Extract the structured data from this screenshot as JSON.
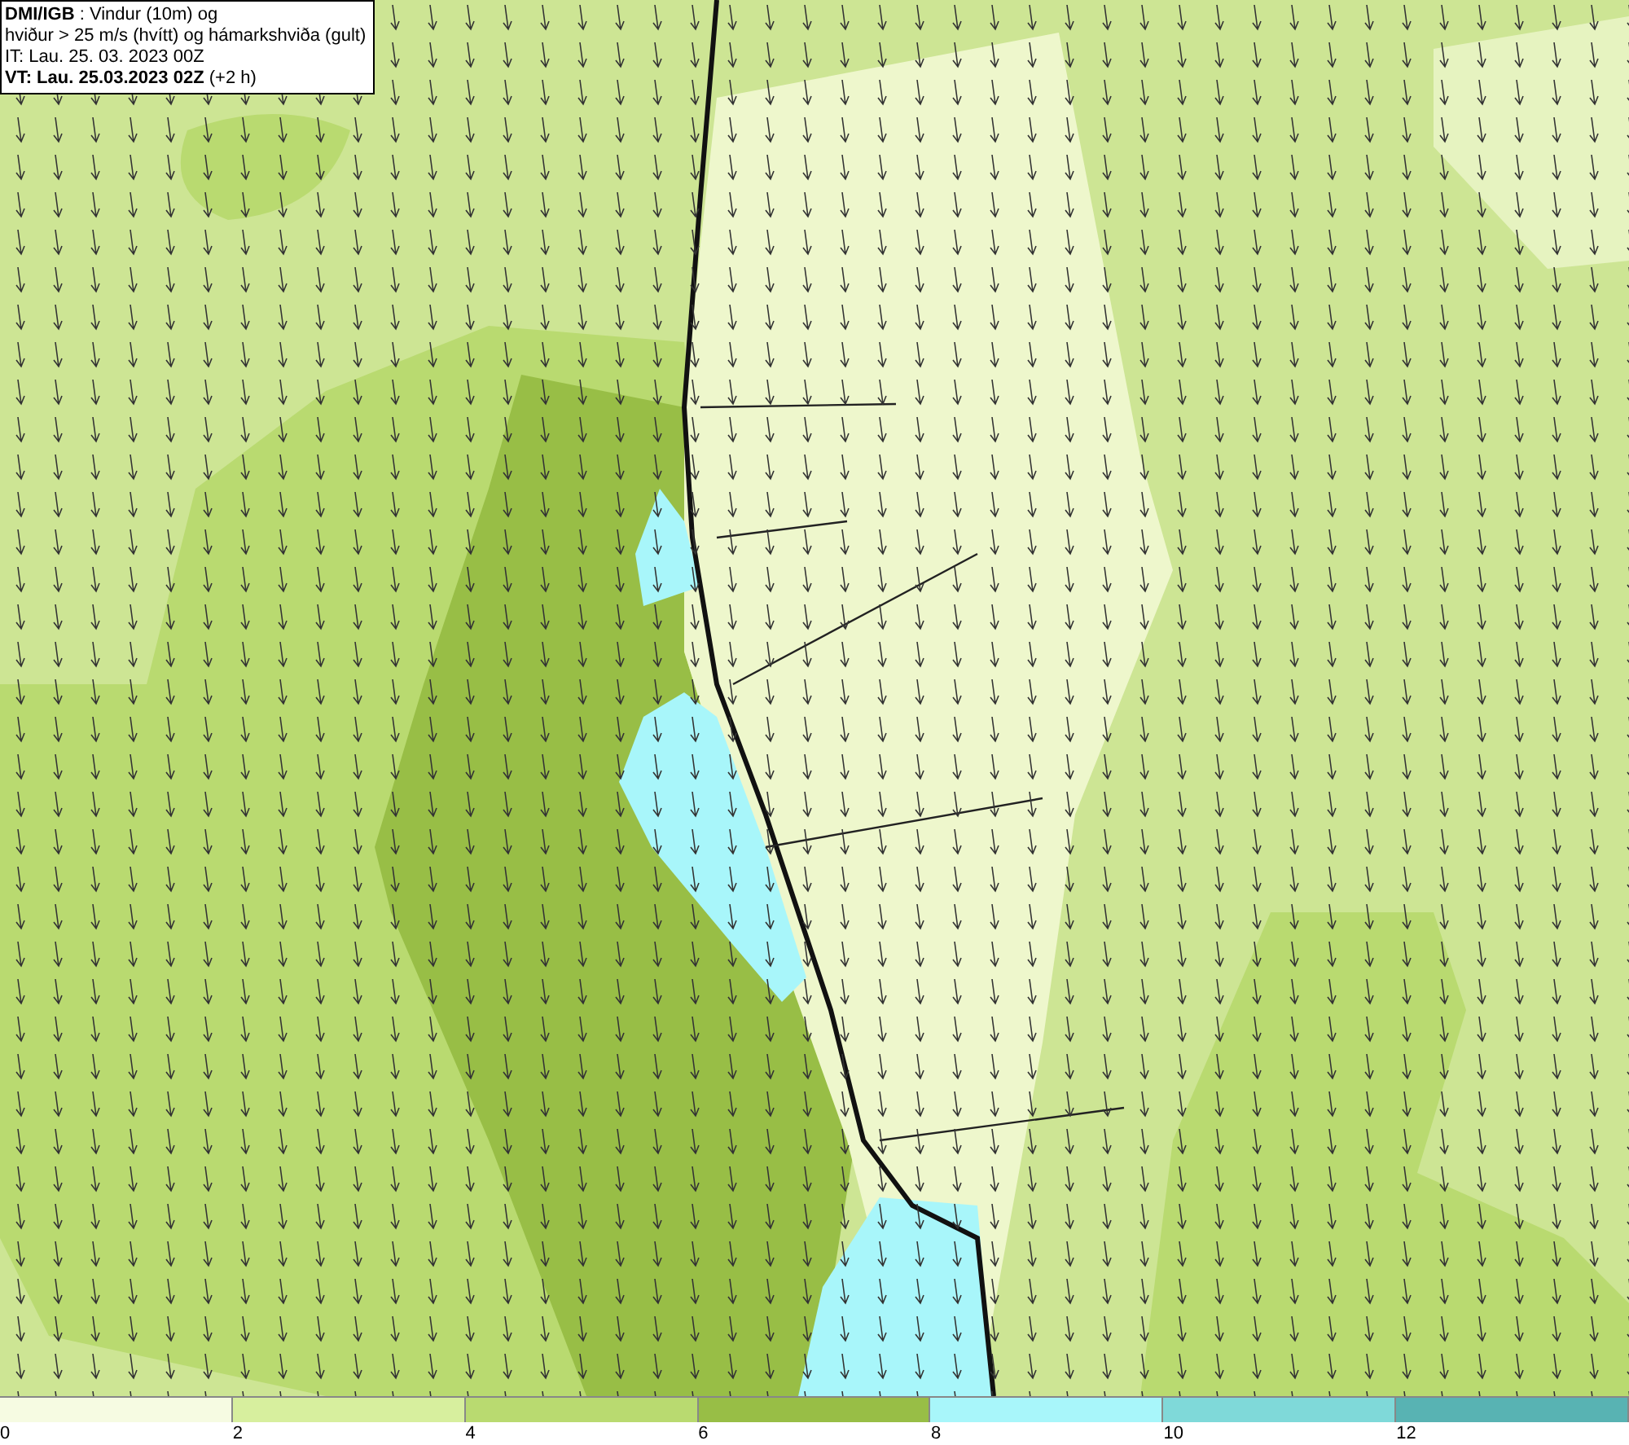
{
  "title_box": {
    "lines": [
      "**DMI/IGB** : Vindur (10m) og",
      "hviður > 25 m/s (hvítt) og hámarkshviða (gult)",
      "IT: Lau. 25. 03. 2023 00Z",
      "**VT: Lau. 25.03.2023 02Z** (+2 h)"
    ]
  },
  "legend": {
    "bins": [
      {
        "label": "0",
        "color": "#f6fbe2"
      },
      {
        "label": "2",
        "color": "#d7ef9e"
      },
      {
        "label": "4",
        "color": "#b9da70"
      },
      {
        "label": "6",
        "color": "#98be46"
      },
      {
        "label": "8",
        "color": "#a8f6fa"
      },
      {
        "label": "10",
        "color": "#7fd9d9"
      },
      {
        "label": "12",
        "color": "#58b3b3"
      }
    ]
  }
}
